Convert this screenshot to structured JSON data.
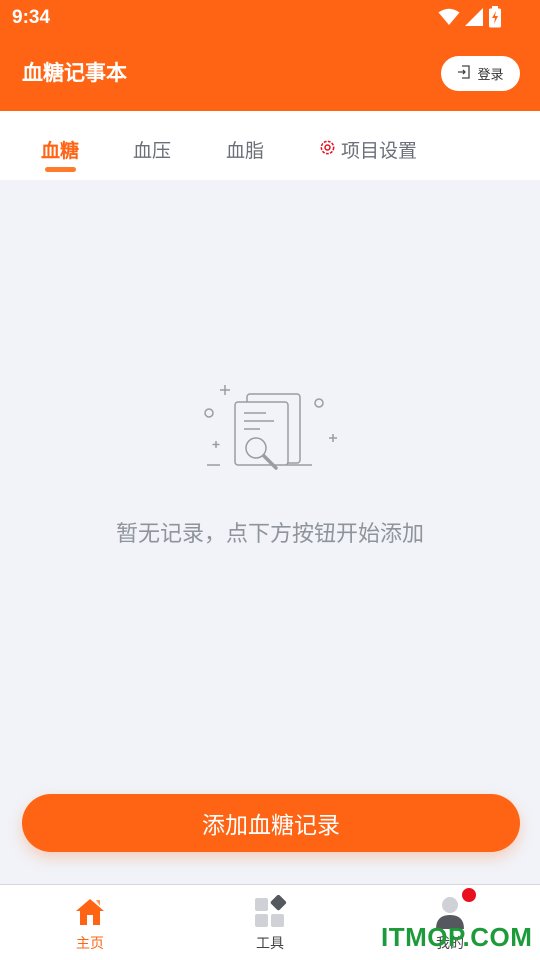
{
  "status_bar": {
    "time": "9:34",
    "icons": [
      "wifi-icon",
      "signal-icon",
      "battery-charging-icon"
    ]
  },
  "header": {
    "title": "血糖记事本",
    "login_label": "登录",
    "bg_color": "#ff6414"
  },
  "tabs": [
    {
      "label": "血糖",
      "active": true
    },
    {
      "label": "血压",
      "active": false
    },
    {
      "label": "血脂",
      "active": false
    },
    {
      "label": "项目设置",
      "active": false,
      "icon": "gear-icon"
    }
  ],
  "empty_state": {
    "icon": "document-search-icon",
    "message": "暂无记录，点下方按钮开始添加"
  },
  "primary_action": {
    "label": "添加血糖记录"
  },
  "bottom_nav": [
    {
      "label": "主页",
      "icon": "home-icon",
      "active": true
    },
    {
      "label": "工具",
      "icon": "tools-icon",
      "active": false
    },
    {
      "label": "我的",
      "icon": "user-icon",
      "active": false,
      "badge": true
    }
  ],
  "watermark": "ITMOP.COM"
}
